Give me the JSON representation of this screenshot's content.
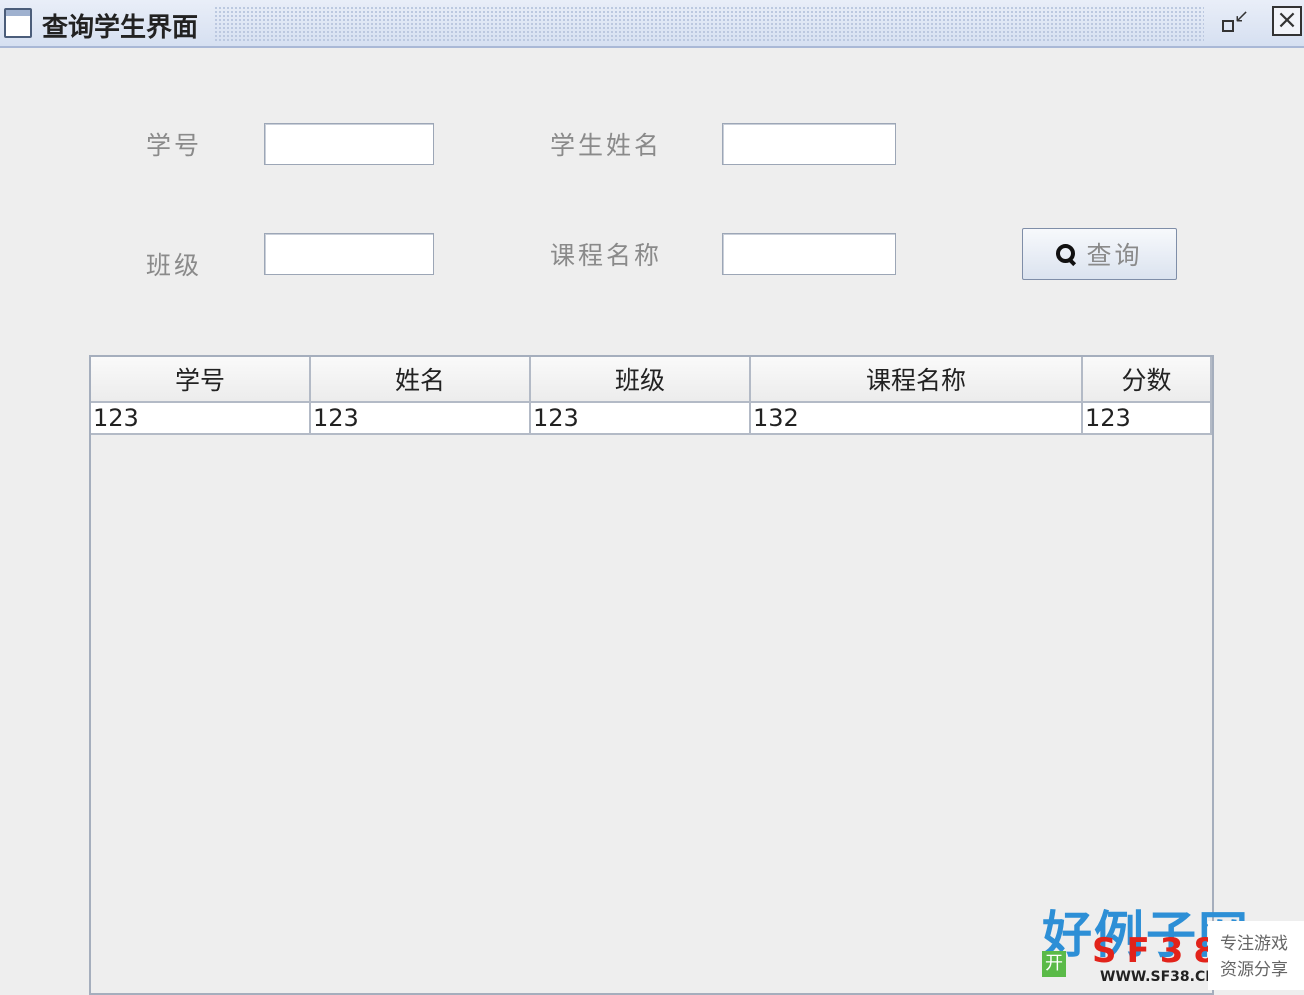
{
  "window": {
    "title": "查询学生界面",
    "restore_glyph": "↙",
    "close_glyph": "×"
  },
  "form": {
    "student_id_label": "学号",
    "student_name_label": "学生姓名",
    "class_label": "班级",
    "course_name_label": "课程名称",
    "student_id_value": "",
    "student_name_value": "",
    "class_value": "",
    "course_name_value": "",
    "search_button_label": "查询",
    "search_icon": "magnifier-icon"
  },
  "table": {
    "columns": [
      "学号",
      "姓名",
      "班级",
      "课程名称",
      "分数"
    ],
    "rows": [
      [
        "123",
        "123",
        "123",
        "132",
        "123"
      ]
    ]
  },
  "watermark": {
    "site_cn": "好例子网",
    "brand": "SF38",
    "url": "WWW.SF38.CN",
    "tag_line1": "专注游戏",
    "tag_line2": "资源分享",
    "open_char": "开",
    "brand_color": "#e2231a",
    "accent_color": "#2d8fd6"
  }
}
